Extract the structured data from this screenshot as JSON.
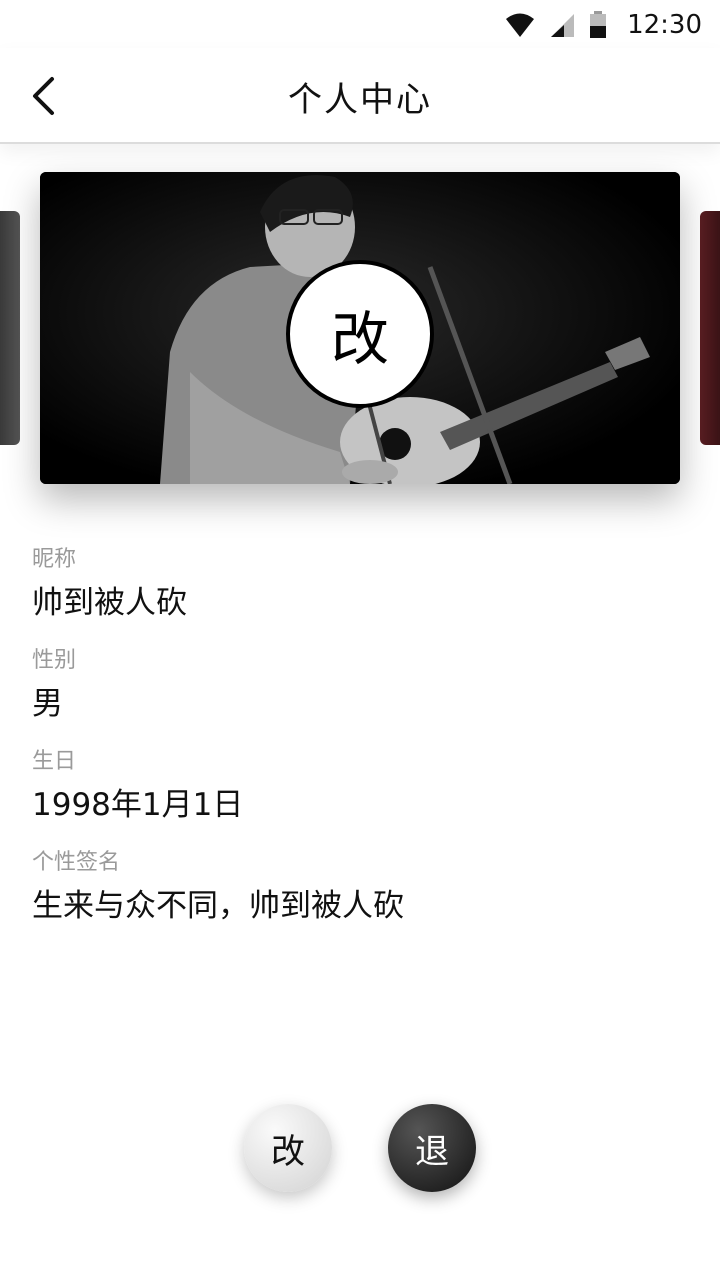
{
  "status_bar": {
    "time": "12:30",
    "icons": [
      "wifi-icon",
      "signal-icon",
      "battery-icon"
    ]
  },
  "header": {
    "back_icon": "chevron-left-icon",
    "title": "个人中心"
  },
  "carousel": {
    "avatar_edit_label": "改"
  },
  "profile": {
    "nickname_label": "昵称",
    "nickname_value": "帅到被人砍",
    "gender_label": "性别",
    "gender_value": "男",
    "birthday_label": "生日",
    "birthday_value": "1998年1月1日",
    "signature_label": "个性签名",
    "signature_value": "生来与众不同，帅到被人砍"
  },
  "actions": {
    "edit_label": "改",
    "logout_label": "退"
  },
  "colors": {
    "label_gray": "#9a9a9a",
    "text": "#111111",
    "divider": "#dcdcdc"
  }
}
